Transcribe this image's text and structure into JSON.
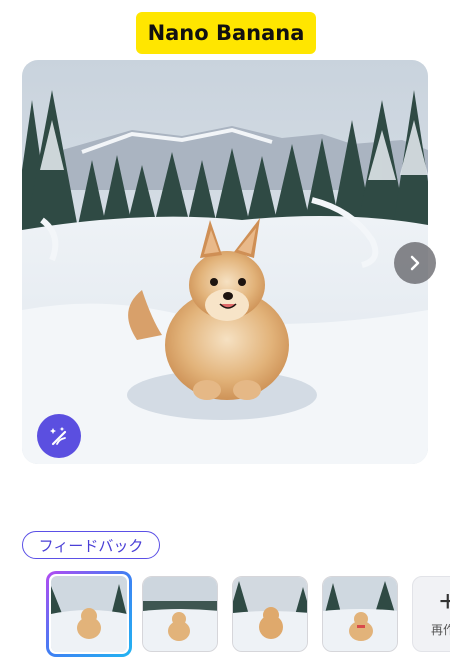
{
  "header": {
    "title": "Nano Banana"
  },
  "hero": {
    "image_subject": "pomeranian-dog-in-snowy-forest"
  },
  "actions": {
    "feedback_label": "フィードバック",
    "regenerate_label": "再作",
    "regenerate_plus": "+"
  },
  "icons": {
    "next": "chevron-right-icon",
    "magic": "magic-edit-icon"
  },
  "thumbnails": [
    {
      "selected": true
    },
    {
      "selected": false
    },
    {
      "selected": false
    },
    {
      "selected": false
    }
  ],
  "colors": {
    "title_bg": "#ffe600",
    "accent": "#5b4fe0",
    "feedback_border": "#5b50e6"
  }
}
